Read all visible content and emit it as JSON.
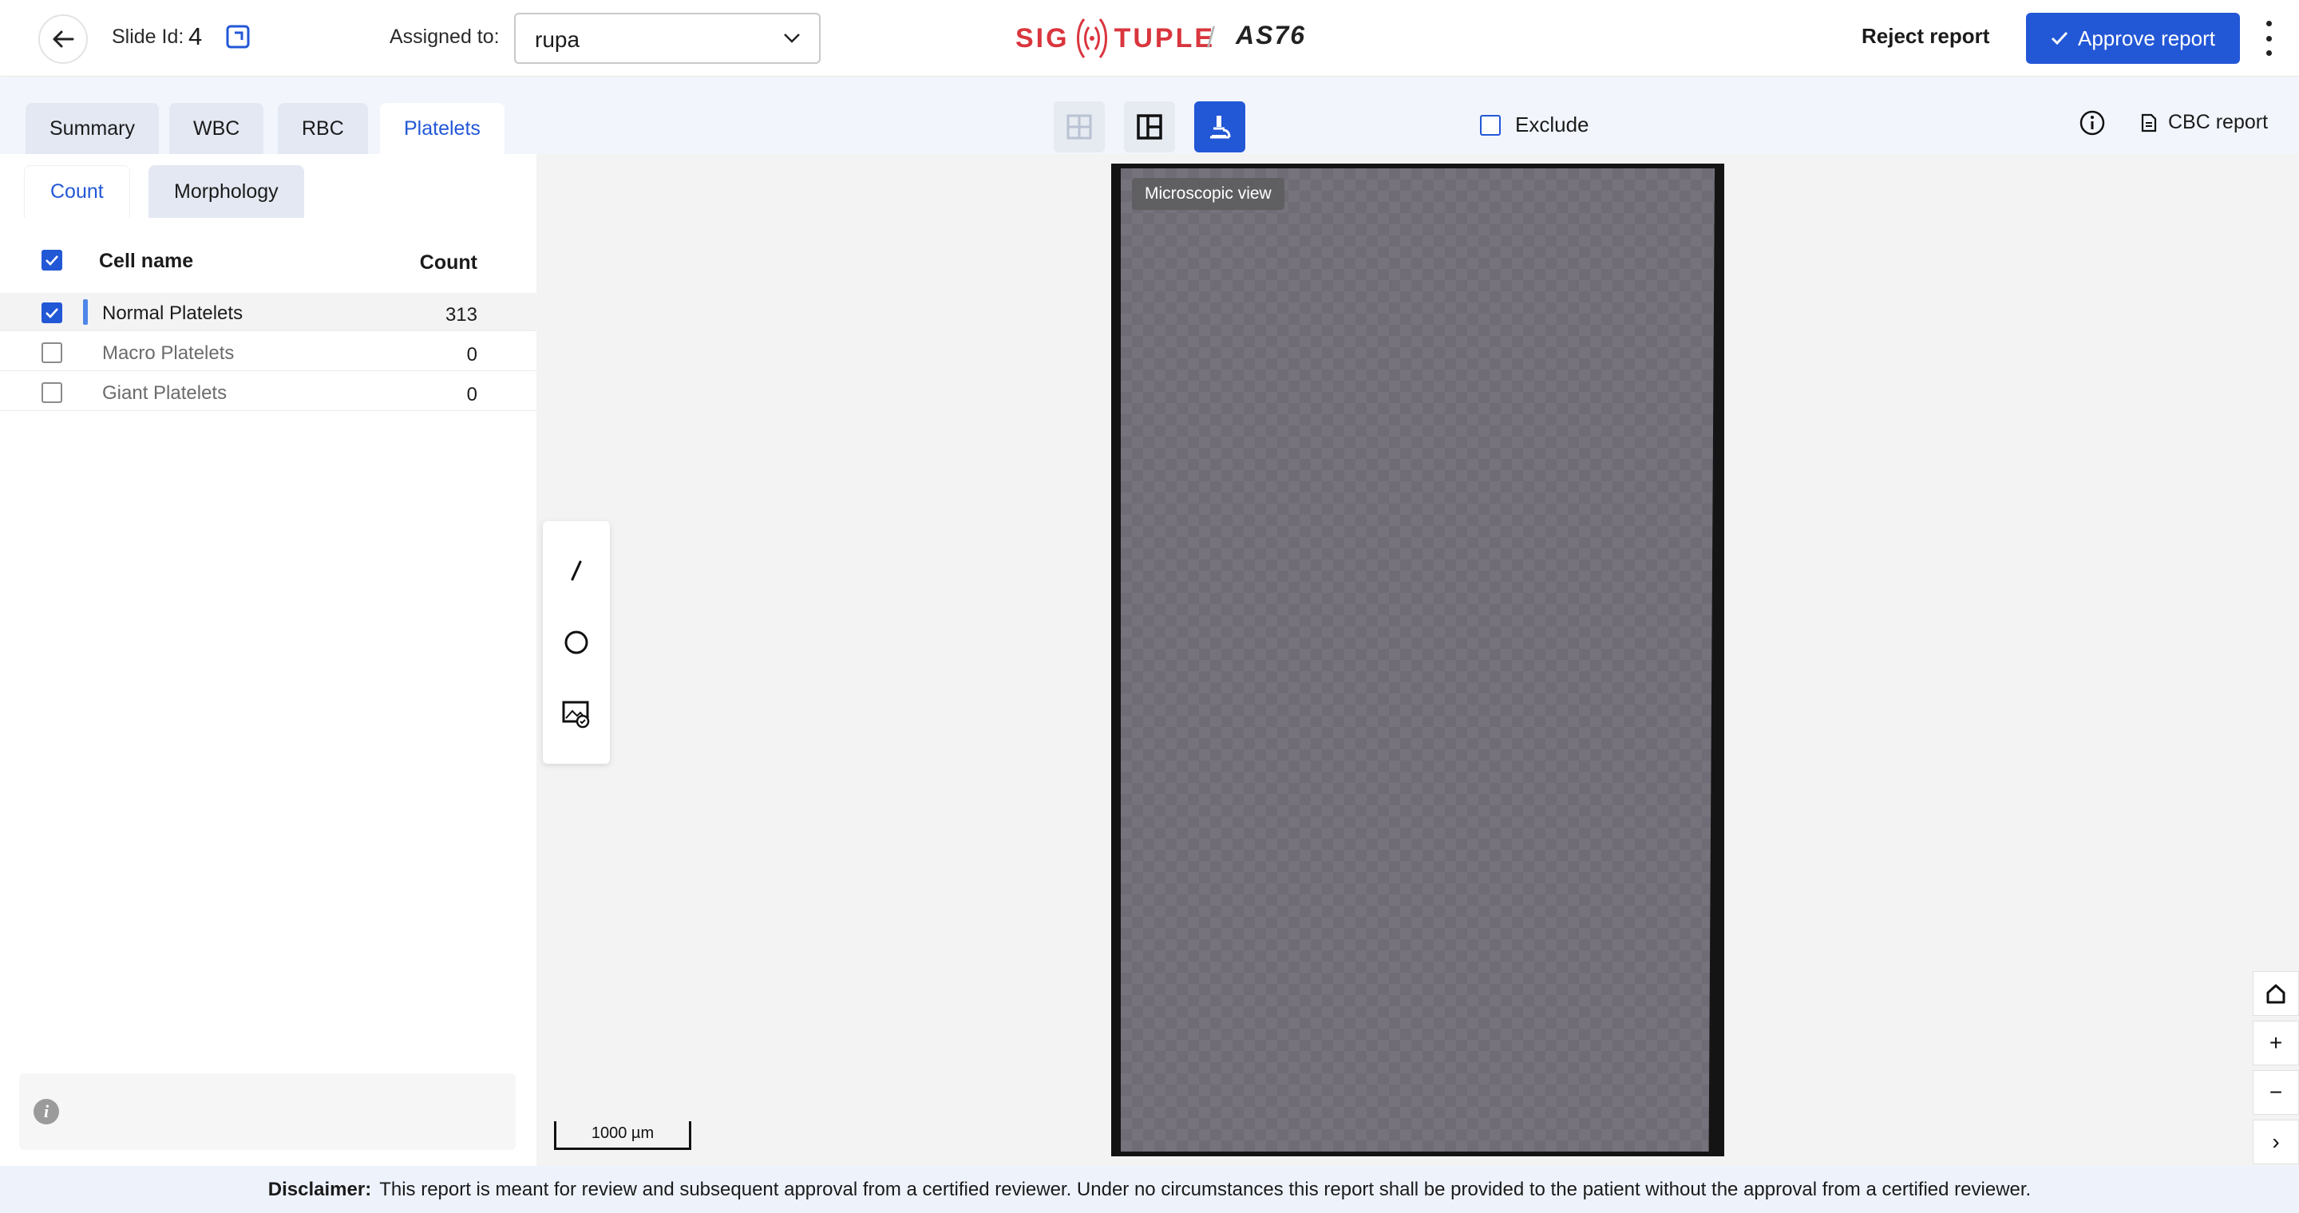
{
  "header": {
    "slide_label": "Slide Id:",
    "slide_id": "4",
    "assigned_label": "Assigned to:",
    "assigned_value": "rupa",
    "logo_text_left": "SIG",
    "logo_text_right": "TUPLE",
    "device_separator": "/",
    "device_name": "AS76",
    "reject_label": "Reject report",
    "approve_label": "Approve report"
  },
  "tabs": [
    "Summary",
    "WBC",
    "RBC",
    "Platelets"
  ],
  "active_tab": "Platelets",
  "toolbar": {
    "exclude_label": "Exclude",
    "cbc_label": "CBC report"
  },
  "subtabs": [
    "Count",
    "Morphology"
  ],
  "table": {
    "col_name": "Cell name",
    "col_count": "Count",
    "rows": [
      {
        "name": "Normal Platelets",
        "count": "313",
        "checked": true
      },
      {
        "name": "Macro Platelets",
        "count": "0",
        "checked": false
      },
      {
        "name": "Giant Platelets",
        "count": "0",
        "checked": false
      }
    ]
  },
  "viewer": {
    "micro_label": "Microscopic view",
    "scale_label": "1000 µm"
  },
  "zoom": {
    "plus": "+",
    "minus": "−",
    "next": "›"
  },
  "footer": {
    "title": "Disclaimer:",
    "text": "This report is meant for review and subsequent approval from a certified reviewer. Under no circumstances this report shall be provided to the patient without the approval from a certified reviewer."
  },
  "colors": {
    "accent": "#2257d6",
    "brand": "#d9363e",
    "subbar": "#f2f5fc"
  },
  "icons": {
    "back": "arrow-left-icon",
    "open": "open-external-icon",
    "chevron": "chevron-down-icon",
    "approve": "check-icon",
    "menu": "kebab-menu-icon",
    "grid": "grid-view-icon",
    "split": "split-view-icon",
    "micro": "microscope-icon",
    "info": "info-icon",
    "doc": "document-icon",
    "line": "line-tool-icon",
    "circle": "circle-tool-icon",
    "select": "image-select-icon",
    "home": "home-icon"
  }
}
